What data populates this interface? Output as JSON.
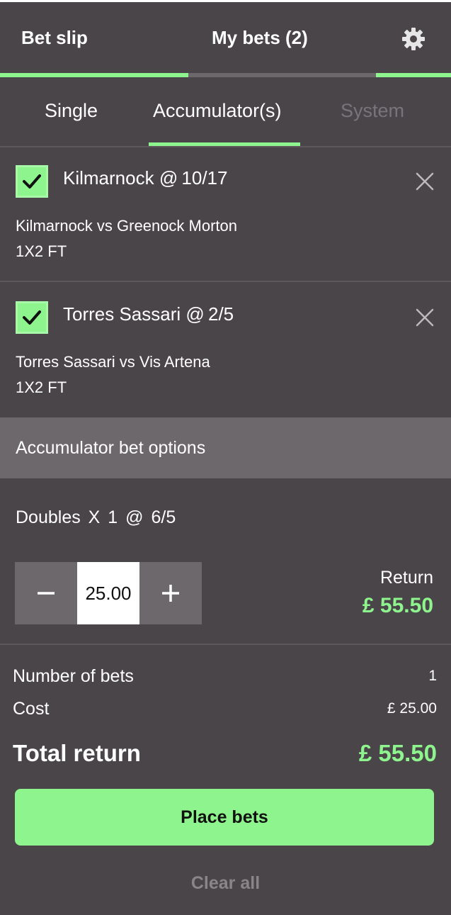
{
  "header": {
    "bet_slip_label": "Bet slip",
    "my_bets_label": "My bets (2)",
    "accent_color": "#8ef58e"
  },
  "subtabs": [
    {
      "label": "Single",
      "state": "normal"
    },
    {
      "label": "Accumulator(s)",
      "state": "active"
    },
    {
      "label": "System",
      "state": "disabled"
    }
  ],
  "selections": [
    {
      "title": "Kilmarnock @ 10/17",
      "match": "Kilmarnock vs Greenock Morton",
      "market": "1X2 FT",
      "checked": true
    },
    {
      "title": "Torres Sassari @ 2/5",
      "match": "Torres Sassari vs Vis Artena",
      "market": "1X2 FT",
      "checked": true
    }
  ],
  "options": {
    "label": "Accumulator bet options"
  },
  "bet": {
    "doubles_text": "Doubles X 1 @ 6/5",
    "stake_value": "25.00",
    "minus_label": "−",
    "plus_label": "+",
    "return_label": "Return",
    "return_value": "£ 55.50"
  },
  "summary": {
    "number_of_bets_label": "Number of bets",
    "number_of_bets_value": "1",
    "cost_label": "Cost",
    "cost_value": "£ 25.00",
    "total_return_label": "Total return",
    "total_return_value": "£ 55.50"
  },
  "actions": {
    "place_bets_label": "Place bets",
    "clear_all_label": "Clear all"
  },
  "icons": {
    "settings": "gear-icon",
    "remove": "close-icon",
    "selected": "checkmark-icon"
  }
}
